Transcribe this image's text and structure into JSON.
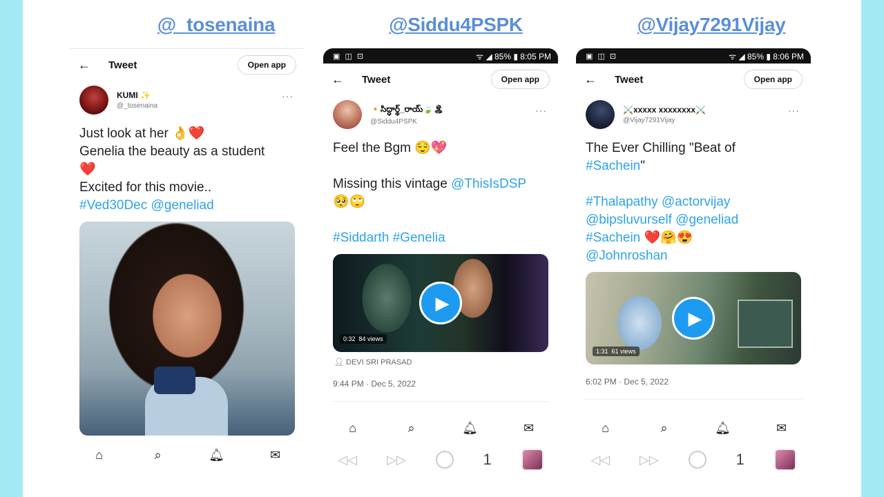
{
  "handles": [
    "@_tosenaina",
    "@Siddu4PSPK",
    "@Vijay7291Vijay"
  ],
  "common": {
    "page_title": "Tweet",
    "open_app": "Open app",
    "back_icon": "arrow-left-icon",
    "more_icon": "more-dots-icon"
  },
  "panel1": {
    "display_name": "KUMI ✨",
    "username": "@_tosenaina",
    "lines": [
      "Just look at her 👌❤️",
      "Genelia the beauty as a student",
      "❤️",
      "Excited for this movie.."
    ],
    "hashtag_line": "#Ved30Dec @geneliad",
    "avatar_color": "#7d1515"
  },
  "panel2": {
    "status_left": "▣ ◫ ⊡",
    "status_right": "ᯤ ◢ 85% ▮ 8:05 PM",
    "display_name": "🔸సిద్ధార్థ్_రాయ్🍃🏝",
    "username": "@Siddu4PSPK",
    "line1": "Feel the Bgm 😌💖",
    "line2_text": "Missing this vintage ",
    "line2_link": "@ThisIsDSP",
    "line3": "🥺🙄",
    "hashtags": "#Siddarth #Genelia",
    "video_duration": "0:32",
    "video_views": "84 views",
    "attribution": "DEVI SRI PRASAD",
    "timestamp": "9:44 PM · Dec 5, 2022"
  },
  "panel3": {
    "status_left": "▣ ◫ ⊡",
    "status_right": "ᯤ ◢ 85% ▮ 8:06 PM",
    "display_name": "⚔️xxxxx xxxxxxxx⚔️",
    "username": "@Vijay7291Vijay",
    "line1": "The Ever Chilling \"Beat of",
    "line2": "#Sachein",
    "line2_suffix": "\"",
    "line3": "#Thalapathy @actorvijay",
    "line4": "@bipsluvurself @geneliad",
    "line5_link": "#Sachein",
    "line5_emoji": " ❤️🤗😍",
    "line6": "@Johnroshan",
    "video_duration": "1:31",
    "video_views": "61 views",
    "timestamp": "6:02 PM · Dec 5, 2022"
  },
  "navbar": {
    "home": "⌂",
    "search": "⌕",
    "bell": "🔔︎",
    "mail": "✉"
  },
  "browser": {
    "back": "◁◁",
    "forward": "▷▷",
    "tabs": "1"
  }
}
